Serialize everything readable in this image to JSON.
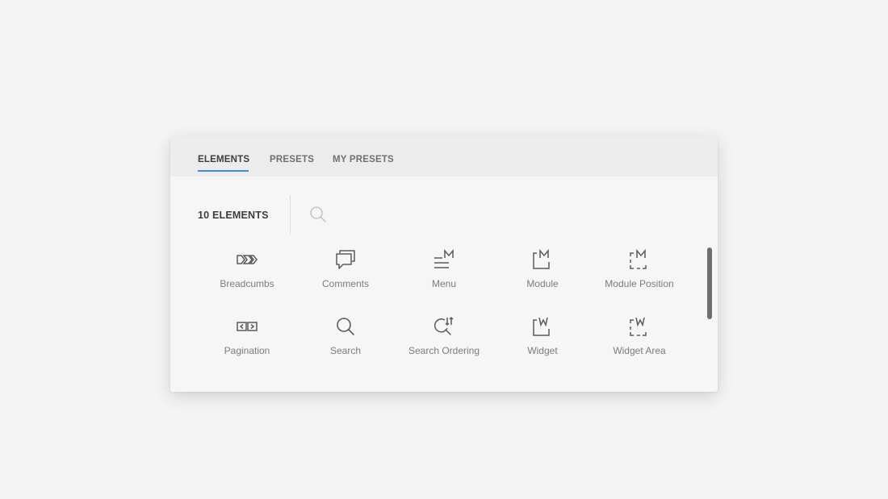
{
  "tabs": [
    {
      "label": "ELEMENTS",
      "active": true
    },
    {
      "label": "PRESETS",
      "active": false
    },
    {
      "label": "MY PRESETS",
      "active": false
    }
  ],
  "element_count": "10 ELEMENTS",
  "search_icon": "search-icon",
  "accent_color": "#3a8de0",
  "elements": [
    {
      "label": "Breadcumbs",
      "icon": "breadcrumbs-icon"
    },
    {
      "label": "Comments",
      "icon": "comments-icon"
    },
    {
      "label": "Menu",
      "icon": "menu-icon"
    },
    {
      "label": "Module",
      "icon": "module-icon"
    },
    {
      "label": "Module Position",
      "icon": "module-position-icon"
    },
    {
      "label": "Pagination",
      "icon": "pagination-icon"
    },
    {
      "label": "Search",
      "icon": "search-icon"
    },
    {
      "label": "Search Ordering",
      "icon": "search-ordering-icon"
    },
    {
      "label": "Widget",
      "icon": "widget-icon"
    },
    {
      "label": "Widget Area",
      "icon": "widget-area-icon"
    }
  ]
}
